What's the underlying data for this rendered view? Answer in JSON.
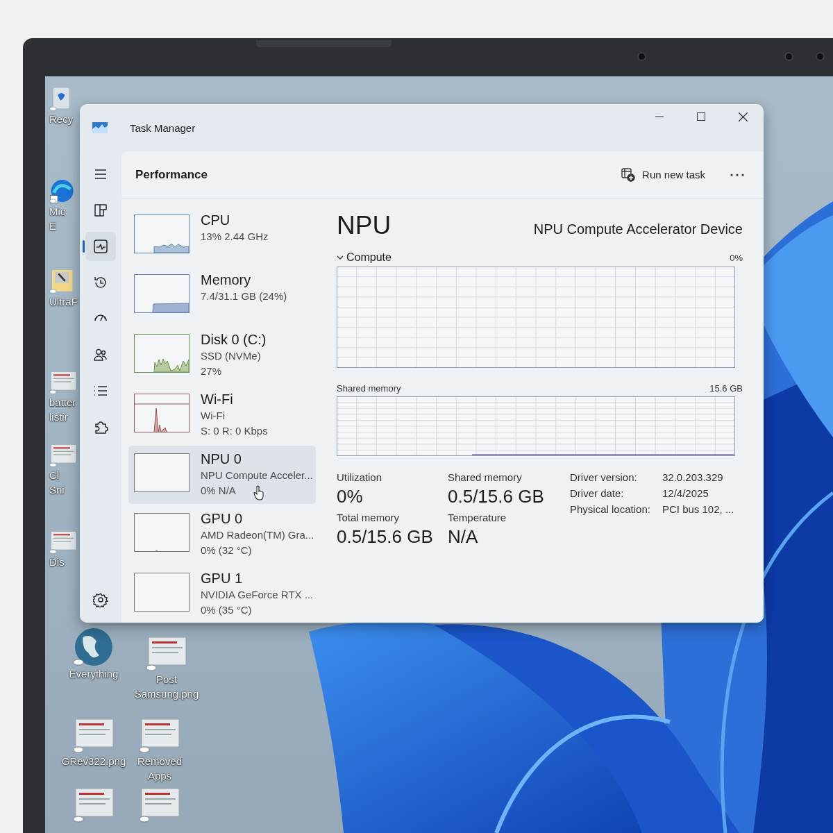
{
  "desktop_icons": [
    {
      "kind": "bin",
      "label": [
        "Recy"
      ]
    },
    {
      "kind": "app",
      "label": [
        "Mic",
        "E"
      ]
    },
    {
      "kind": "folder",
      "label": [
        "UltraF"
      ]
    },
    {
      "kind": "file",
      "label": [
        "batter",
        "listir"
      ]
    },
    {
      "kind": "file",
      "label": [
        "Cl",
        "Sni"
      ]
    },
    {
      "kind": "file",
      "label": [
        "Dis"
      ]
    },
    {
      "kind": "globe",
      "label": [
        "Everything"
      ]
    },
    {
      "kind": "file",
      "label": [
        "Post",
        "Samsung.png"
      ]
    },
    {
      "kind": "file",
      "label": [
        "GRev322.png"
      ]
    },
    {
      "kind": "file",
      "label": [
        "Removed",
        "Apps"
      ]
    },
    {
      "kind": "file"
    },
    {
      "kind": "file"
    }
  ],
  "window": {
    "title": "Task Manager"
  },
  "nav": [
    {
      "selected": false
    },
    {
      "selected": false
    },
    {
      "selected": true
    },
    {
      "selected": false
    },
    {
      "selected": false
    },
    {
      "selected": false
    },
    {
      "selected": false
    },
    {
      "selected": false
    },
    {
      "selected": false
    }
  ],
  "header": {
    "title": "Performance",
    "run_task": "Run new task"
  },
  "devices": [
    {
      "name": "CPU",
      "details": [
        "13% 2.44 GHz"
      ],
      "selected": false
    },
    {
      "name": "Memory",
      "details": [
        "7.4/31.1 GB (24%)"
      ],
      "selected": false
    },
    {
      "name": "Disk 0 (C:)",
      "details": [
        "SSD (NVMe)",
        "27%"
      ],
      "selected": false
    },
    {
      "name": "Wi-Fi",
      "details": [
        "Wi-Fi",
        "S: 0 R: 0 Kbps"
      ],
      "selected": false
    },
    {
      "name": "NPU 0",
      "details": [
        "NPU Compute Acceler...",
        "0% N/A"
      ],
      "selected": true
    },
    {
      "name": "GPU 0",
      "details": [
        "AMD Radeon(TM) Gra...",
        "0% (32 °C)"
      ],
      "selected": false
    },
    {
      "name": "GPU 1",
      "details": [
        "NVIDIA GeForce RTX ...",
        "0% (35 °C)"
      ],
      "selected": false
    }
  ],
  "detail": {
    "title": "NPU",
    "device": "NPU Compute Accelerator Device",
    "compute": {
      "label": "Compute",
      "expanded": true,
      "max": "0%"
    },
    "shared": {
      "label": "Shared memory",
      "max": "15.6 GB"
    },
    "stats": [
      {
        "label": "Utilization",
        "value": "0%"
      },
      {
        "label": "Shared memory",
        "value": "0.5/15.6 GB"
      },
      {
        "label": "Total memory",
        "value": "0.5/15.6 GB"
      },
      {
        "label": "Temperature",
        "value": "N/A"
      }
    ],
    "info": [
      {
        "label": "Driver version:",
        "value": "32.0.203.329"
      },
      {
        "label": "Driver date:",
        "value": "12/4/2025"
      },
      {
        "label": "Physical location:",
        "value": "PCI bus 102, ..."
      }
    ]
  }
}
